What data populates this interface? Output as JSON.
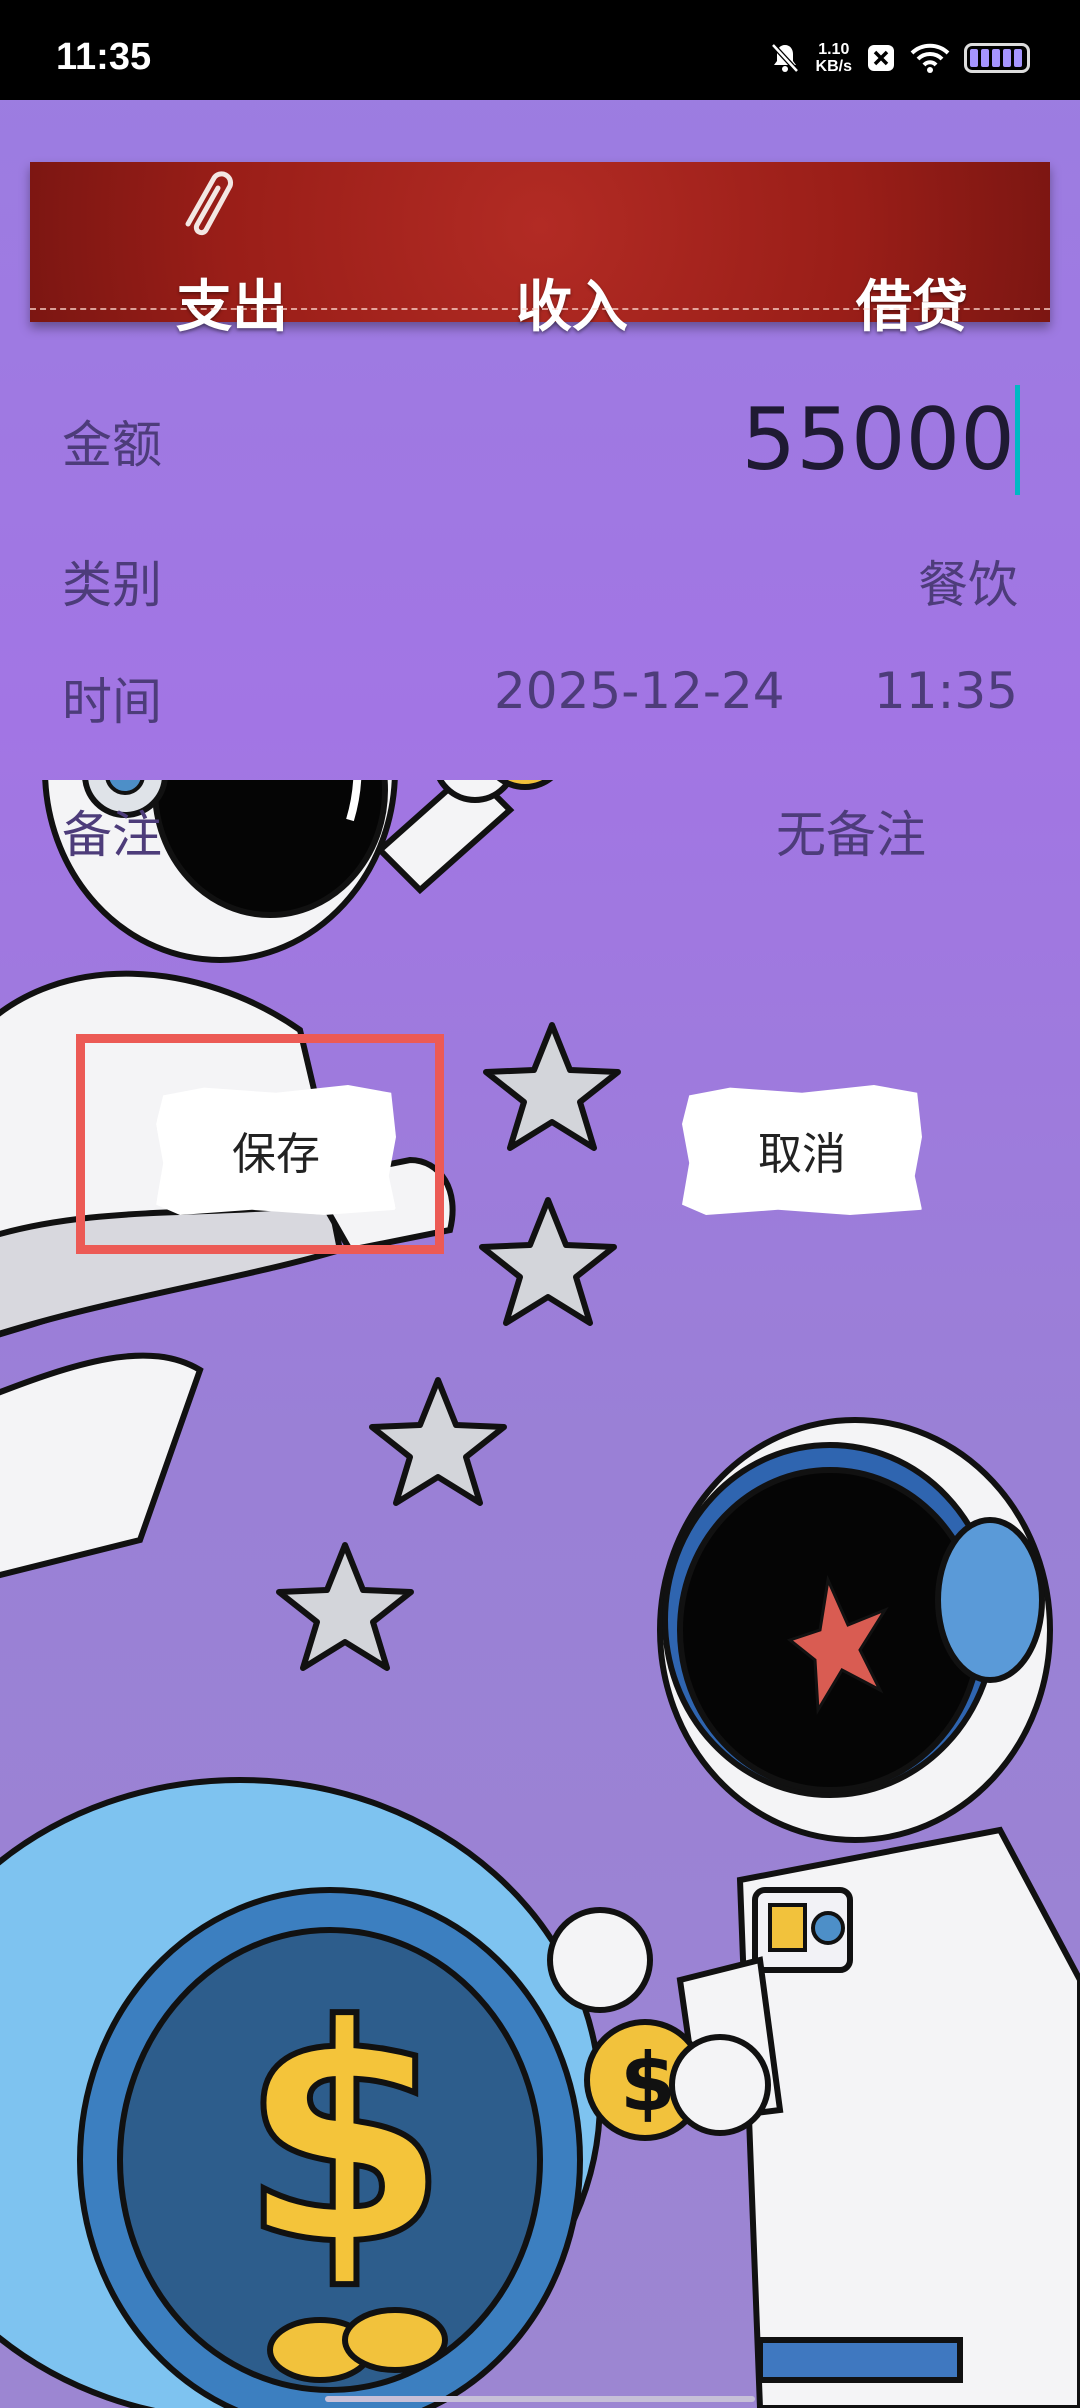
{
  "status_bar": {
    "time": "11:35",
    "net_speed_value": "1.10",
    "net_speed_unit": "KB/s"
  },
  "tabs": [
    "支出",
    "收入",
    "借贷"
  ],
  "form": {
    "amount_label": "金额",
    "amount_value": "55000",
    "category_label": "类别",
    "category_value": "餐饮",
    "time_label": "时间",
    "date_value": "2025-12-24",
    "time_value": "11:35",
    "note_label": "备注",
    "note_value": "无备注"
  },
  "buttons": {
    "save": "保存",
    "cancel": "取消"
  },
  "colors": {
    "banner": "#9a1e18",
    "highlight": "#ec5a55",
    "background": "#a275e4"
  }
}
